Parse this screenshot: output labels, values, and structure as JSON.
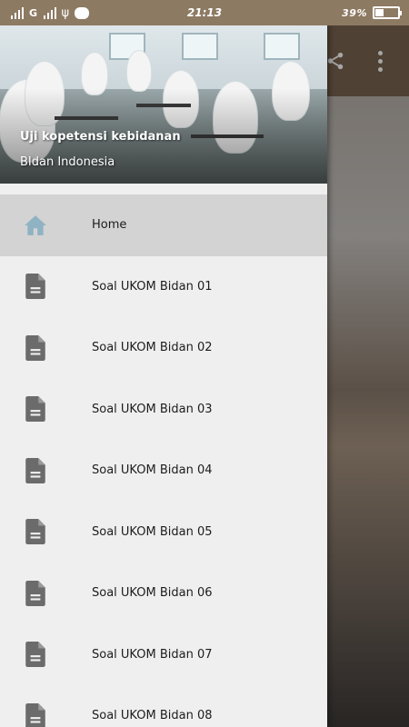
{
  "status_bar": {
    "carrier": "G",
    "time": "21:13",
    "battery": "39%",
    "battery_level": 0.39
  },
  "drawer": {
    "header": {
      "title": "Uji kopetensi kebidanan",
      "subtitle": "BIdan Indonesia"
    },
    "items": [
      {
        "label": "Home",
        "icon": "home-icon",
        "active": true
      },
      {
        "label": "Soal UKOM Bidan 01",
        "icon": "document-icon"
      },
      {
        "label": "Soal UKOM Bidan 02",
        "icon": "document-icon"
      },
      {
        "label": "Soal UKOM Bidan 03",
        "icon": "document-icon"
      },
      {
        "label": "Soal UKOM Bidan 04",
        "icon": "document-icon"
      },
      {
        "label": "Soal UKOM Bidan 05",
        "icon": "document-icon"
      },
      {
        "label": "Soal UKOM Bidan 06",
        "icon": "document-icon"
      },
      {
        "label": "Soal UKOM Bidan 07",
        "icon": "document-icon"
      },
      {
        "label": "Soal UKOM Bidan 08",
        "icon": "document-icon"
      }
    ]
  },
  "background_toolbar": {
    "actions": [
      "share-icon",
      "more-vert-icon"
    ]
  },
  "colors": {
    "status_bar": "#8d7a63",
    "toolbar": "#7a6450",
    "drawer_bg": "#efefef",
    "active_item": "#d3d3d3",
    "home_icon": "#8fb3c3",
    "document_icon": "#6b6b6b"
  }
}
